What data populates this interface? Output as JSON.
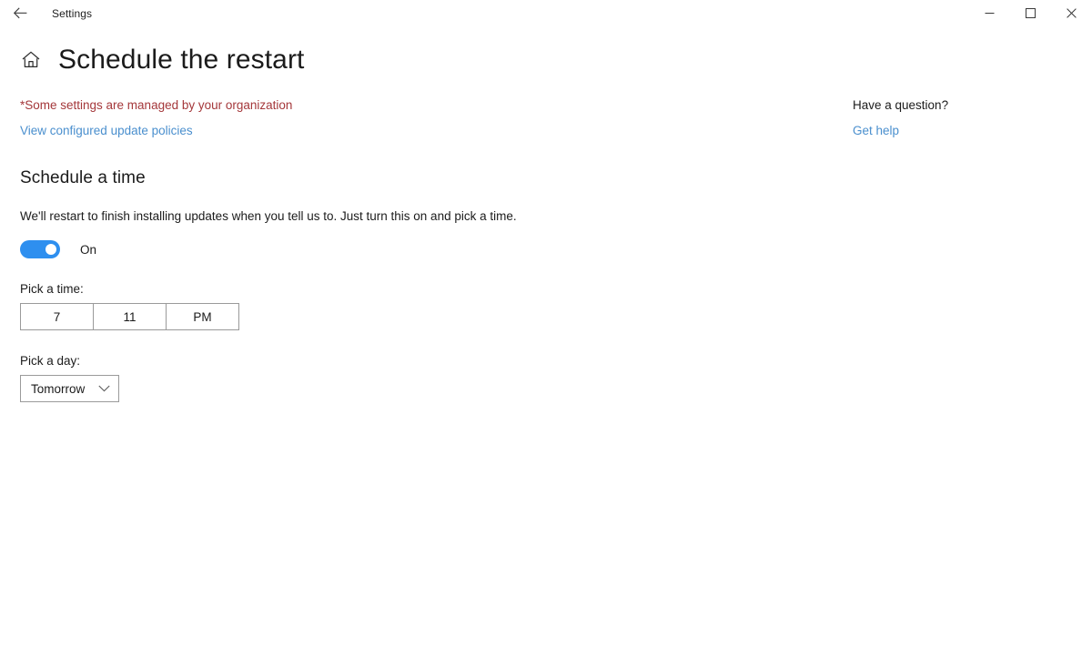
{
  "titlebar": {
    "back_icon": "back-arrow-icon",
    "app_title": "Settings",
    "minimize_icon": "minimize-icon",
    "maximize_icon": "maximize-icon",
    "close_icon": "close-icon"
  },
  "header": {
    "home_icon": "home-icon",
    "title": "Schedule the restart"
  },
  "notice": {
    "org_managed": "*Some settings are managed by your organization",
    "policy_link": "View configured update policies"
  },
  "help": {
    "heading": "Have a question?",
    "link": "Get help"
  },
  "schedule": {
    "section_heading": "Schedule a time",
    "description": "We'll restart to finish installing updates when you tell us to. Just turn this on and pick a time.",
    "toggle_state": "On",
    "toggle_on": true,
    "time_label": "Pick a time:",
    "time_hour": "7",
    "time_minute": "11",
    "time_meridiem": "PM",
    "day_label": "Pick a day:",
    "day_value": "Tomorrow",
    "chevron_icon": "chevron-down-icon"
  },
  "colors": {
    "accent_blue": "#2e8fef",
    "link_blue": "#4a8fce",
    "warning_red": "#a4373a",
    "border_gray": "#9a9a9a",
    "text": "#1b1b1b"
  }
}
